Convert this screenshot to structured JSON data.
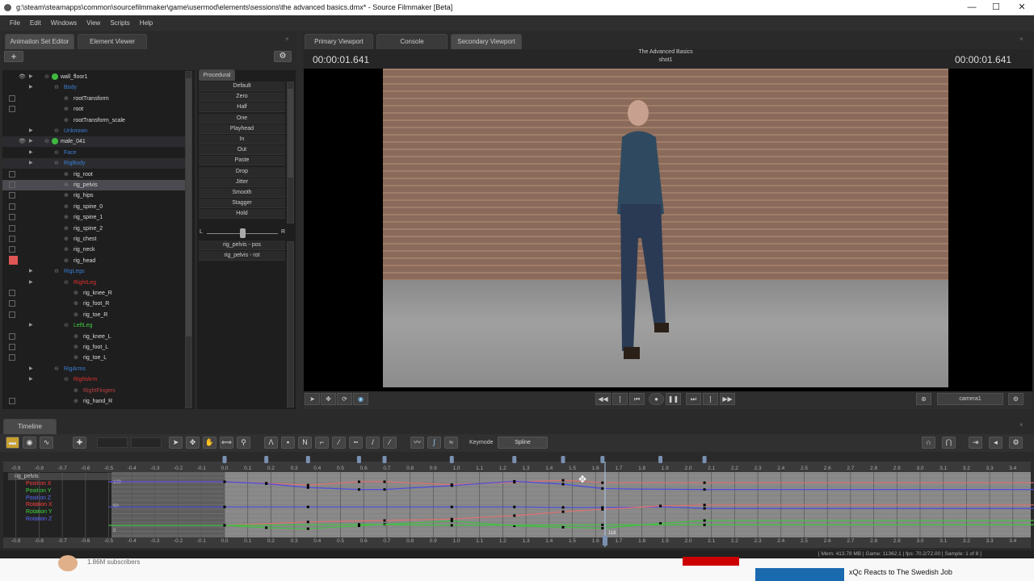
{
  "window": {
    "title": "g:\\steam\\steamapps\\common\\sourcefilmmaker\\game\\usermod\\elements\\sessions\\the advanced basics.dmx* - Source Filmmaker [Beta]",
    "min": "—",
    "max": "☐",
    "close": "✕"
  },
  "menu": [
    "File",
    "Edit",
    "Windows",
    "View",
    "Scripts",
    "Help"
  ],
  "left_tabs": [
    "Animation Set Editor",
    "Element Viewer"
  ],
  "tree": [
    {
      "label": "wall_floor1",
      "level": 0,
      "color": "#dddddd",
      "eye": true,
      "tri": true,
      "chk": false,
      "icon": true
    },
    {
      "label": "Body",
      "level": 1,
      "color": "#3a7fd5",
      "tri": true,
      "chk": false
    },
    {
      "label": "rootTransform",
      "level": 2,
      "color": "#dddddd",
      "chk": true
    },
    {
      "label": "root",
      "level": 2,
      "color": "#dddddd",
      "chk": true
    },
    {
      "label": "rootTransform_scale",
      "level": 2,
      "color": "#dddddd",
      "chk": false
    },
    {
      "label": "Unknown",
      "level": 1,
      "color": "#3a7fd5",
      "tri": true,
      "chk": false
    },
    {
      "label": "male_041",
      "level": 0,
      "color": "#dddddd",
      "eye": true,
      "tri": true,
      "chk": false,
      "icon": true,
      "hl": true
    },
    {
      "label": "Face",
      "level": 1,
      "color": "#3a7fd5",
      "tri": true,
      "chk": false
    },
    {
      "label": "RigBody",
      "level": 1,
      "color": "#3a7fd5",
      "tri": true,
      "chk": false,
      "hl": true
    },
    {
      "label": "rig_root",
      "level": 2,
      "color": "#dddddd",
      "chk": true
    },
    {
      "label": "rig_pelvis",
      "level": 2,
      "color": "#dddddd",
      "chk": true,
      "sel": true
    },
    {
      "label": "rig_hips",
      "level": 2,
      "color": "#dddddd",
      "chk": true
    },
    {
      "label": "rig_spine_0",
      "level": 2,
      "color": "#dddddd",
      "chk": true
    },
    {
      "label": "rig_spine_1",
      "level": 2,
      "color": "#dddddd",
      "chk": true
    },
    {
      "label": "rig_spine_2",
      "level": 2,
      "color": "#dddddd",
      "chk": true
    },
    {
      "label": "rig_chest",
      "level": 2,
      "color": "#dddddd",
      "chk": true
    },
    {
      "label": "rig_neck",
      "level": 2,
      "color": "#dddddd",
      "chk": true
    },
    {
      "label": "rig_head",
      "level": 2,
      "color": "#dddddd",
      "chk": true,
      "red": true
    },
    {
      "label": "RigLegs",
      "level": 1,
      "color": "#3a7fd5",
      "tri": true
    },
    {
      "label": "RightLeg",
      "level": 2,
      "color": "#e03030",
      "tri": true
    },
    {
      "label": "rig_knee_R",
      "level": 3,
      "color": "#dddddd",
      "chk": true
    },
    {
      "label": "rig_foot_R",
      "level": 3,
      "color": "#dddddd",
      "chk": true
    },
    {
      "label": "rig_toe_R",
      "level": 3,
      "color": "#dddddd",
      "chk": true
    },
    {
      "label": "LeftLeg",
      "level": 2,
      "color": "#3fcf3f",
      "tri": true
    },
    {
      "label": "rig_knee_L",
      "level": 3,
      "color": "#dddddd",
      "chk": true
    },
    {
      "label": "rig_foot_L",
      "level": 3,
      "color": "#dddddd",
      "chk": true
    },
    {
      "label": "rig_toe_L",
      "level": 3,
      "color": "#dddddd",
      "chk": true
    },
    {
      "label": "RigArms",
      "level": 1,
      "color": "#3a7fd5",
      "tri": true
    },
    {
      "label": "RightArm",
      "level": 2,
      "color": "#e03030",
      "tri": true
    },
    {
      "label": "RightFingers",
      "level": 3,
      "color": "#c04040"
    },
    {
      "label": "rig_hand_R",
      "level": 3,
      "color": "#dddddd",
      "chk": true
    }
  ],
  "procedural": {
    "tab": "Procedural",
    "items": [
      "Default",
      "Zero",
      "Half",
      "One",
      "Playhead",
      "In",
      "Out",
      "Paste",
      "Drop",
      "Jitter",
      "Smooth",
      "Stagger",
      "Hold"
    ],
    "slider_left": "L",
    "slider_right": "R",
    "slider_value": 0.5,
    "controls": [
      "rig_pelvis - pos",
      "rig_pelvis - rot"
    ]
  },
  "viewport": {
    "tabs": [
      "Primary Viewport",
      "Console",
      "Secondary Viewport"
    ],
    "time_left": "00:00:01.641",
    "time_right": "00:00:01.641",
    "title": "The Advanced Basics",
    "shot": "shot1",
    "camera": "camera1"
  },
  "timeline": {
    "tab": "Timeline",
    "keymode_label": "Keymode",
    "keymode": "Spline",
    "channels_root": "rig_pelvis",
    "channels": [
      {
        "name": "Position X",
        "color": "#ff4040"
      },
      {
        "name": "Position Y",
        "color": "#3fdc3f"
      },
      {
        "name": "Position Z",
        "color": "#5a6aff"
      },
      {
        "name": "Rotation X",
        "color": "#ff4040"
      },
      {
        "name": "Rotation Y",
        "color": "#3fdc3f"
      },
      {
        "name": "Rotation Z",
        "color": "#5a6aff"
      }
    ],
    "y_labels": [
      "100",
      "50",
      "0"
    ],
    "playhead_time": 1.641,
    "playhead_frame": "118",
    "keys": [
      0,
      0.18,
      0.36,
      0.58,
      0.69,
      0.98,
      1.25,
      1.46,
      1.63,
      1.88,
      2.07
    ],
    "curves": [
      {
        "color": "#e07070",
        "pts": [
          [
            -0.5,
            100
          ],
          [
            0,
            100
          ],
          [
            0.18,
            97
          ],
          [
            0.36,
            93
          ],
          [
            0.58,
            100
          ],
          [
            0.69,
            100
          ],
          [
            0.98,
            94
          ],
          [
            1.25,
            99
          ],
          [
            1.46,
            103
          ],
          [
            1.63,
            98
          ],
          [
            2.07,
            98
          ],
          [
            3.5,
            98
          ]
        ]
      },
      {
        "color": "#4a4ae0",
        "pts": [
          [
            -0.5,
            100
          ],
          [
            0,
            100
          ],
          [
            0.18,
            96
          ],
          [
            0.36,
            88
          ],
          [
            0.58,
            84
          ],
          [
            0.69,
            84
          ],
          [
            0.98,
            92
          ],
          [
            1.25,
            101
          ],
          [
            1.46,
            95
          ],
          [
            1.63,
            86
          ],
          [
            1.75,
            85
          ],
          [
            2.07,
            84
          ],
          [
            3.5,
            84
          ]
        ]
      },
      {
        "color": "#4a4ae0",
        "pts": [
          [
            -0.5,
            48
          ],
          [
            0,
            48
          ],
          [
            0.36,
            48
          ],
          [
            0.98,
            48
          ],
          [
            1.25,
            48
          ],
          [
            1.46,
            47
          ],
          [
            1.63,
            47
          ],
          [
            1.9,
            48
          ],
          [
            2.07,
            45
          ],
          [
            3.5,
            45
          ]
        ]
      },
      {
        "color": "#e07070",
        "pts": [
          [
            0,
            10
          ],
          [
            0.36,
            17
          ],
          [
            0.69,
            20
          ],
          [
            0.98,
            23
          ],
          [
            1.25,
            30
          ],
          [
            1.46,
            38
          ],
          [
            1.63,
            43
          ],
          [
            1.88,
            50
          ],
          [
            2.07,
            52
          ],
          [
            3.5,
            52
          ]
        ]
      },
      {
        "color": "#40c040",
        "pts": [
          [
            -0.5,
            10
          ],
          [
            0,
            10
          ],
          [
            0.18,
            5
          ],
          [
            0.36,
            3
          ],
          [
            0.58,
            9
          ],
          [
            0.69,
            12
          ],
          [
            0.98,
            19
          ],
          [
            1.25,
            9
          ],
          [
            1.46,
            6
          ],
          [
            1.63,
            4
          ],
          [
            1.88,
            14
          ],
          [
            2.07,
            20
          ],
          [
            3.5,
            20
          ]
        ]
      },
      {
        "color": "#40c040",
        "pts": [
          [
            0,
            10
          ],
          [
            0.58,
            12
          ],
          [
            0.98,
            10
          ],
          [
            1.63,
            11
          ],
          [
            2.07,
            11
          ],
          [
            3.5,
            11
          ]
        ]
      }
    ]
  },
  "status": {
    "mem_label": "Mem:",
    "mem": "413.78 MB",
    "game_label": "Game:",
    "game": "11362.1",
    "fps_label": "fps:",
    "fps": "70.2/72.00",
    "sample_label": "Sample:",
    "sample": "1 of 8"
  },
  "background_page": {
    "subscribers": "1.86M subscribers",
    "video_title": "xQc Reacts to The Swedish Job"
  }
}
